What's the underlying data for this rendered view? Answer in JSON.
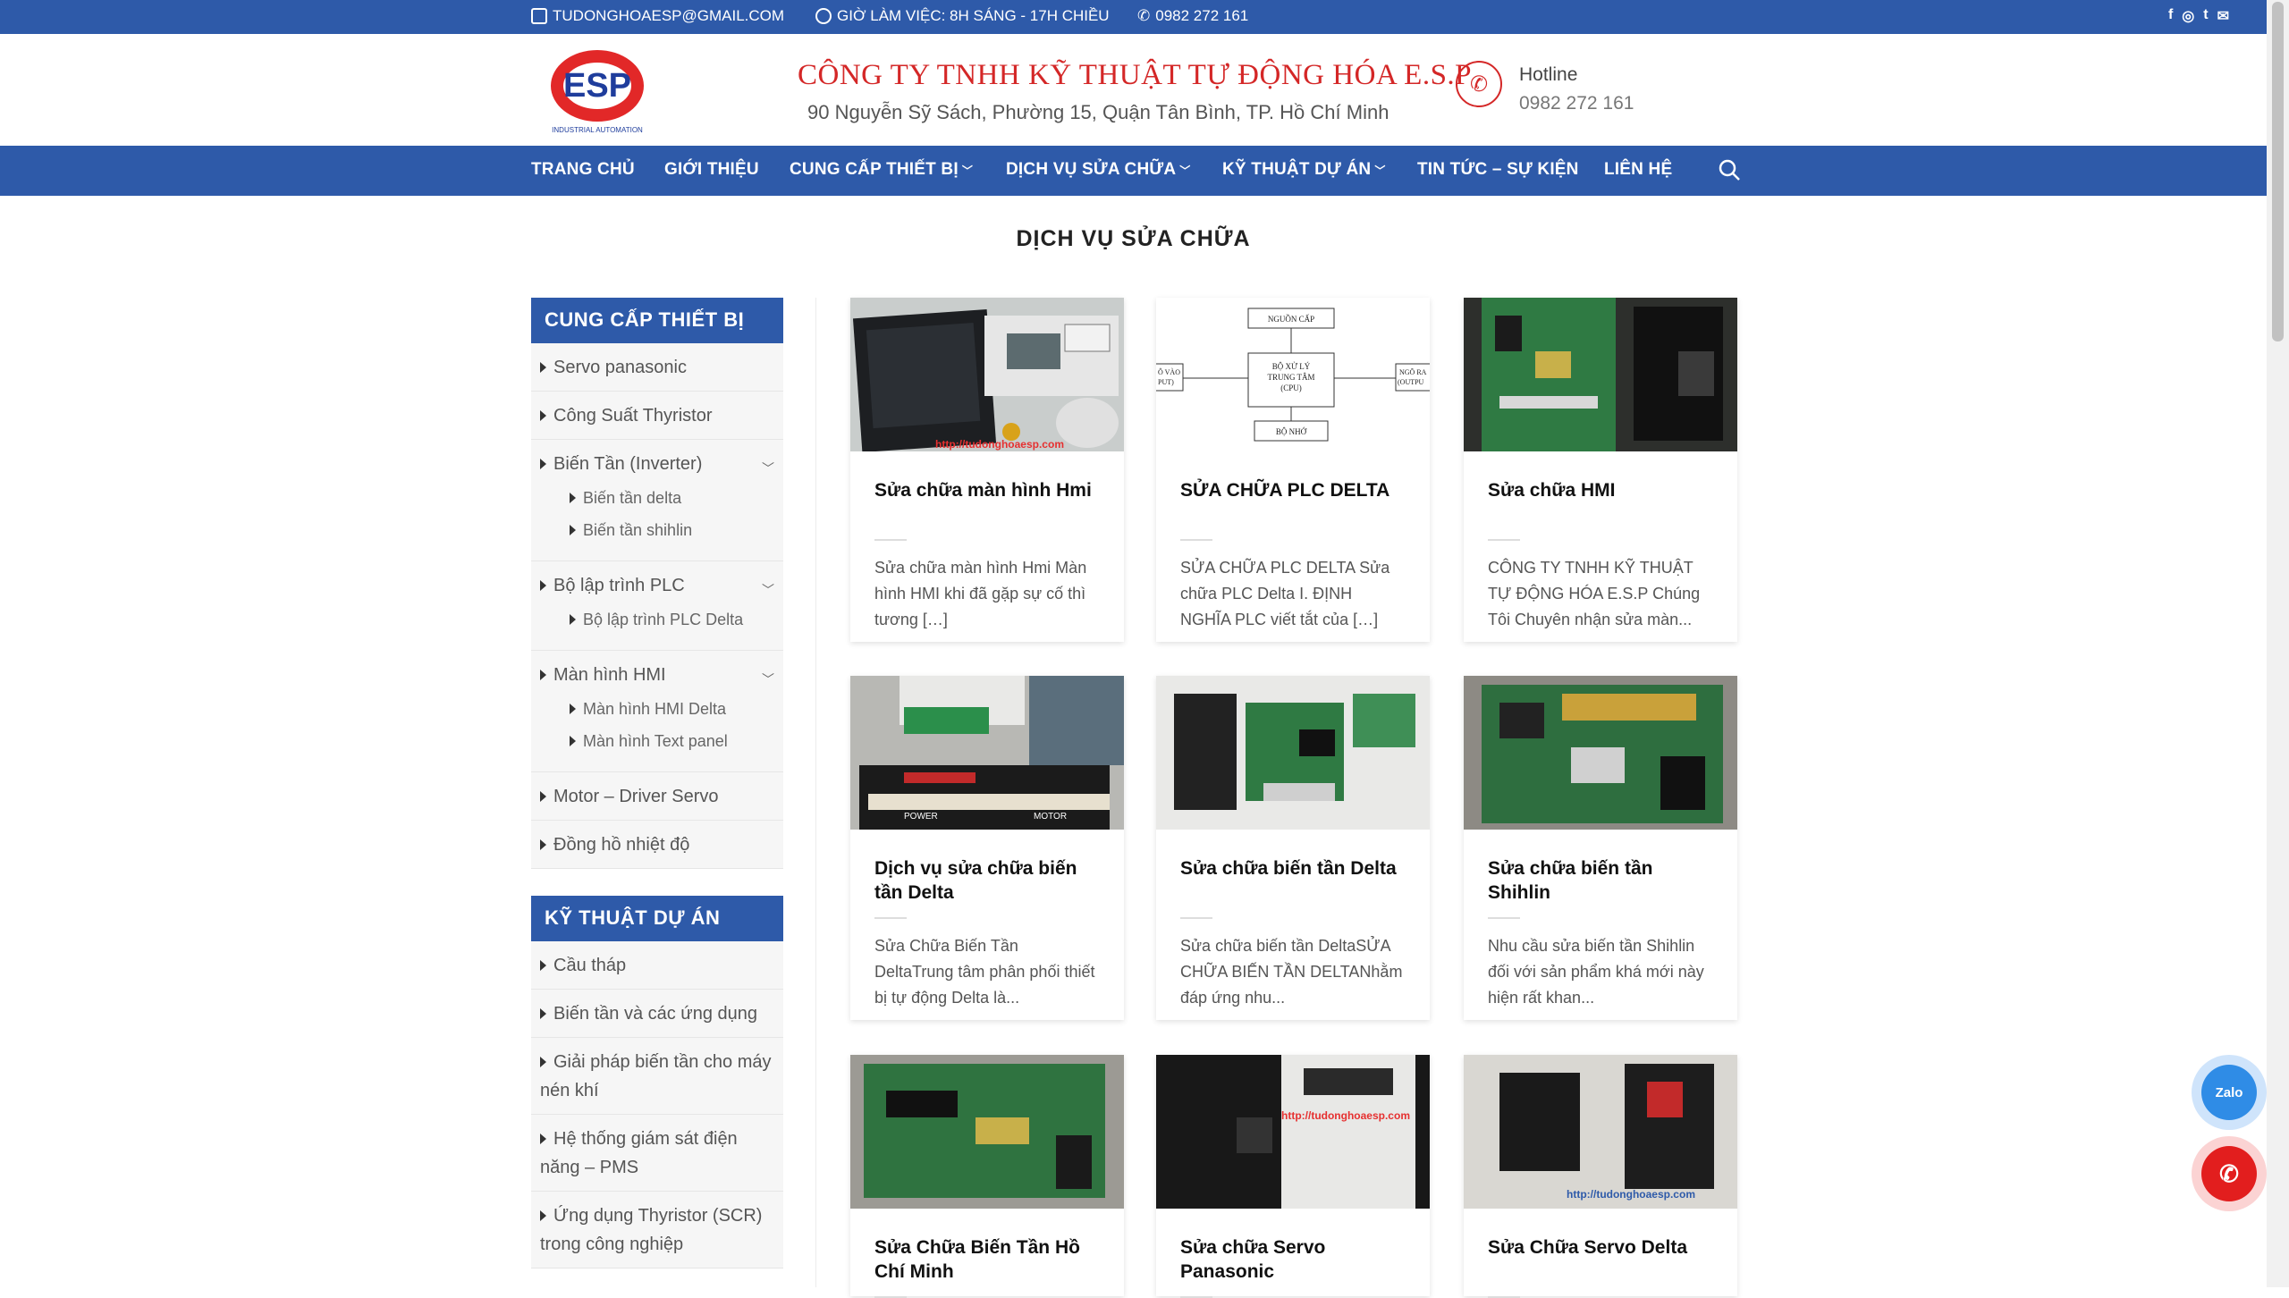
{
  "topbar": {
    "email": "TUDONGHOAESP@GMAIL.COM",
    "hours": "GIỜ LÀM VIỆC: 8H SÁNG - 17H CHIỀU",
    "phone": "0982 272 161",
    "social_icons": [
      "facebook-icon",
      "instagram-icon",
      "twitter-icon",
      "email-icon"
    ]
  },
  "header": {
    "logo_text": "ESP",
    "logo_tagline": "INDUSTRIAL AUTOMATION",
    "company_name": "CÔNG TY TNHH KỸ THUẬT TỰ ĐỘNG HÓA E.S.P",
    "address": "90 Nguyễn Sỹ Sách, Phường 15, Quận Tân Bình, TP. Hồ Chí Minh",
    "hotline_label": "Hotline",
    "hotline_value": "0982 272 161"
  },
  "nav": {
    "items": [
      "TRANG CHỦ",
      "GIỚI THIỆU",
      "CUNG CẤP THIẾT BỊ",
      "DỊCH VỤ SỬA CHỮA",
      "KỸ THUẬT DỰ ÁN",
      "TIN TỨC – SỰ KIỆN",
      "LIÊN HỆ"
    ]
  },
  "page_title": "DỊCH VỤ SỬA CHỮA",
  "sidebar": {
    "section1_title": "CUNG CẤP THIẾT BỊ",
    "section1_items": {
      "servo": "Servo panasonic",
      "thyristor": "Công Suất Thyristor",
      "inverter": "Biến Tần (Inverter)",
      "inverter_sub": [
        "Biến tần delta",
        "Biến tần shihlin"
      ],
      "plc": "Bộ lập trình PLC",
      "plc_sub": [
        "Bộ lập trình PLC Delta"
      ],
      "hmi": "Màn hình HMI",
      "hmi_sub": [
        "Màn hình HMI Delta",
        "Màn hình Text panel"
      ],
      "motor": "Motor – Driver Servo",
      "temp": "Đồng hồ nhiệt độ"
    },
    "section2_title": "KỸ THUẬT DỰ ÁN",
    "section2_items": [
      "Cầu tháp",
      "Biến tần và các ứng dụng",
      "Giải pháp biến tần cho máy nén khí",
      "Hệ thống giám sát điện năng – PMS",
      "Ứng dụng Thyristor (SCR) trong công nghiệp"
    ]
  },
  "posts": [
    {
      "title": "Sửa chữa màn hình Hmi",
      "excerpt": "Sửa chữa màn hình Hmi Màn hình HMI khi đã gặp sự cố thì tương […]",
      "watermark": "http://tudonghoaesp.com"
    },
    {
      "title": "SỬA CHỮA PLC DELTA",
      "excerpt": "SỬA CHỮA PLC DELTA Sửa chữa PLC Delta I. ĐỊNH NGHĨA PLC viết tắt của […]",
      "diagram": {
        "top": "NGUỒN CẤP",
        "center1": "BỘ XỬ LÝ",
        "center2": "TRUNG TÂM",
        "center3": "(CPU)",
        "bottom": "BỘ NHỚ",
        "left1": "Ô VÀO",
        "left2": "PUT)",
        "right1": "NGÕ RA",
        "right2": "(OUTPU"
      }
    },
    {
      "title": "Sửa chữa HMI",
      "excerpt": "CÔNG TY TNHH KỸ THUẬT TỰ ĐỘNG HÓA E.S.P Chúng Tôi Chuyên nhận sửa màn..."
    },
    {
      "title": "Dịch vụ sửa chữa biến tần Delta",
      "excerpt": "Sửa Chữa Biến Tần DeltaTrung tâm phân phối thiết bị tự động Delta là...",
      "label_power": "POWER",
      "label_motor": "MOTOR"
    },
    {
      "title": "Sửa chữa biến tần Delta",
      "excerpt": "Sửa chữa biến tần DeltaSỬA CHỮA BIẾN TẦN DELTANhằm đáp ứng nhu..."
    },
    {
      "title": "Sửa chữa biến tần Shihlin",
      "excerpt": "Nhu cầu sửa biến tần Shihlin đối với sản phẩm khá mới này hiện rất khan..."
    },
    {
      "title": "Sửa Chữa Biến Tần Hồ Chí Minh",
      "excerpt": ""
    },
    {
      "title": "Sửa chữa Servo Panasonic",
      "excerpt": "",
      "watermark": "http://tudonghoaesp.com"
    },
    {
      "title": "Sửa Chữa Servo Delta",
      "excerpt": "",
      "watermark": "http://tudonghoaesp.com"
    }
  ],
  "floating": {
    "zalo_label": "Zalo"
  },
  "colors": {
    "brand_blue": "#2e5aa9",
    "brand_red": "#d42727"
  }
}
